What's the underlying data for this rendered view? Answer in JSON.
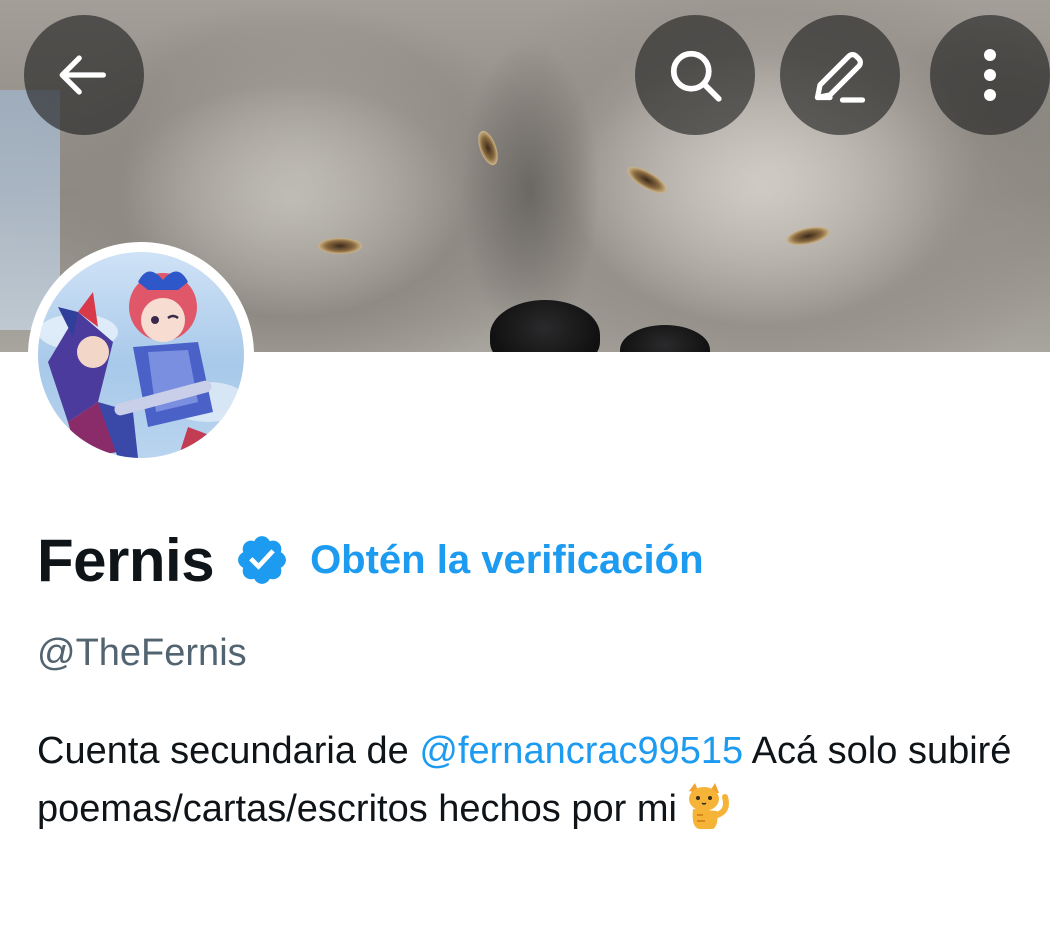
{
  "profile": {
    "display_name": "Fernis",
    "get_verified_label": "Obtén la verificación",
    "handle": "@TheFernis",
    "bio": {
      "prefix": "Cuenta secundaria de",
      "mention": "@fernancrac99515",
      "suffix": "Acá solo subiré poemas/cartas/escritos hechos por mi",
      "emoji": "cat-icon"
    }
  },
  "toolbar": {
    "back_icon": "arrow-left-icon",
    "search_icon": "search-icon",
    "compose_icon": "pencil-icon",
    "more_icon": "more-vertical-icon"
  },
  "colors": {
    "accent": "#1d9bf0",
    "text_primary": "#0f1419",
    "text_secondary": "#536471"
  }
}
